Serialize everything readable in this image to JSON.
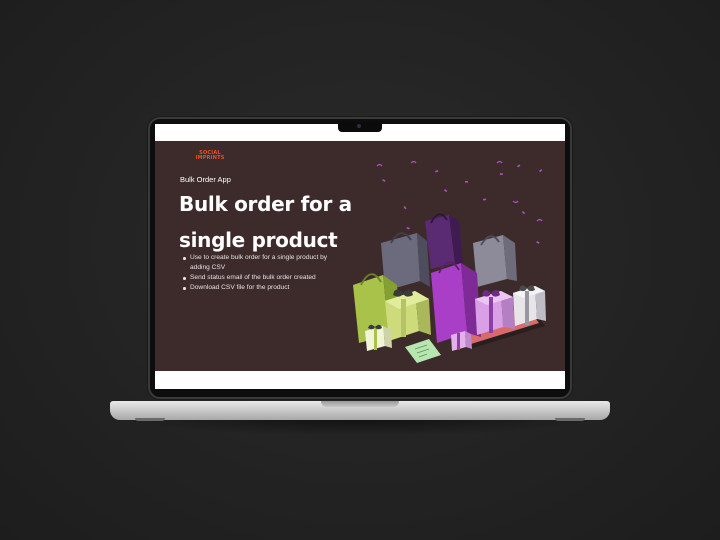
{
  "brand": {
    "line1": "SOCIAL",
    "line2": "IMPRINTS",
    "tagline": "",
    "accent_color": "#e8502a"
  },
  "banner": {
    "background_color": "#3d2b2b",
    "app_label": "Bulk Order App",
    "headline": "Bulk order for a single product",
    "bullets": [
      "Use to create bulk order for a single product by adding CSV",
      "Send status email of the bulk order created",
      "Download CSV file for the product"
    ]
  },
  "illustration": {
    "subject": "shopping-bags-and-gift-boxes",
    "colors": [
      "#a8c24a",
      "#6e3a8a",
      "#b04fc8",
      "#d9a0e6",
      "#8a8a9a",
      "#e7e4ea"
    ]
  }
}
